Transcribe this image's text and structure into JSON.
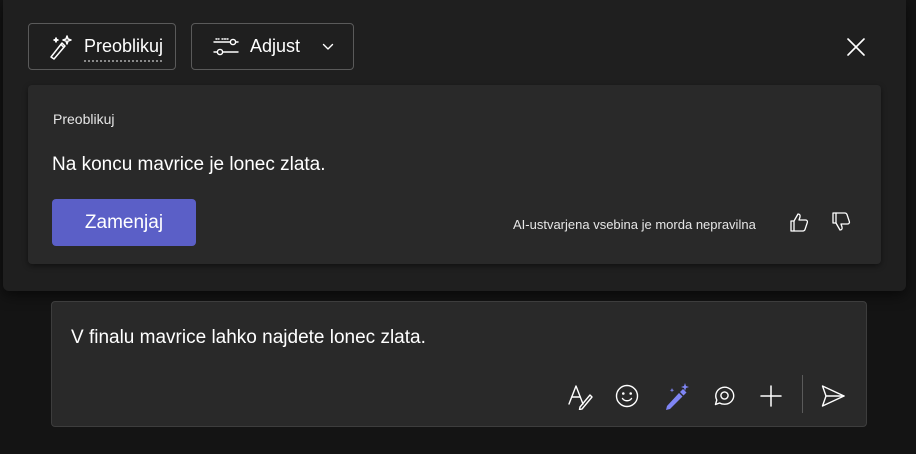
{
  "toolbar": {
    "rewrite_label": "Preoblikuj",
    "adjust_label": "Adjust"
  },
  "suggestion": {
    "label": "Preoblikuj",
    "text": "Na koncu mavrice je lonec zlata.",
    "replace_label": "Zamenjaj",
    "disclaimer": "AI-ustvarjena vsebina je morda nepravilna"
  },
  "compose": {
    "text": "V finalu mavrice lahko najdete lonec zlata."
  },
  "icons": {
    "rewrite": "sparkle-pen-icon",
    "adjust": "sliders-icon",
    "chevron": "chevron-down-icon",
    "close": "close-icon",
    "thumbs_up": "thumbs-up-icon",
    "thumbs_down": "thumbs-down-icon",
    "format": "format-text-icon",
    "emoji": "emoji-icon",
    "copilot": "copilot-pen-icon",
    "loop": "loop-icon",
    "add": "plus-icon",
    "send": "send-icon"
  },
  "colors": {
    "accent": "#5b5fc7",
    "copilot_icon": "#7f85f5",
    "background": "#141414",
    "popup": "#1f1f1f",
    "card": "#292929"
  }
}
